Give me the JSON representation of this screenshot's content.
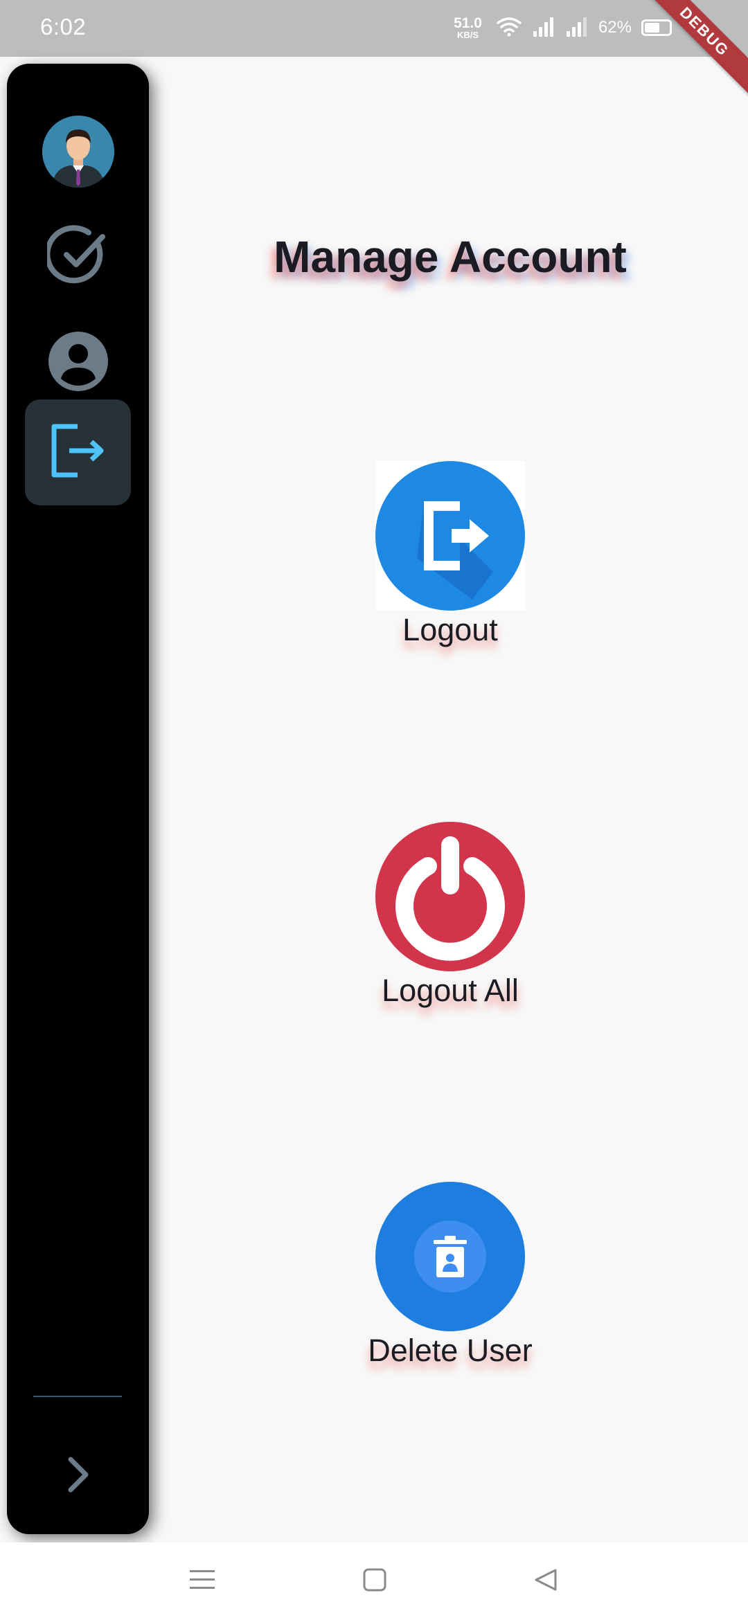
{
  "status_bar": {
    "time": "6:02",
    "net_speed_value": "51.0",
    "net_speed_unit": "KB/S",
    "battery_percent": "62%",
    "battery_level": 0.62
  },
  "debug_banner": "DEBUG",
  "sidebar": {
    "items": [
      {
        "name": "avatar",
        "icon": "user-avatar"
      },
      {
        "name": "tasks",
        "icon": "check-circle-icon"
      },
      {
        "name": "profile",
        "icon": "account-circle-icon"
      },
      {
        "name": "logout",
        "icon": "logout-icon",
        "active": true
      }
    ],
    "expand_icon": "chevron-right-icon",
    "accent_color": "#4fc3f7"
  },
  "main": {
    "title": "Manage Account",
    "actions": [
      {
        "label": "Logout",
        "icon": "logout-icon",
        "color": "#1e88e5"
      },
      {
        "label": "Logout All",
        "icon": "power-icon",
        "color": "#d1344b"
      },
      {
        "label": "Delete User",
        "icon": "delete-user-icon",
        "color": "#1e7ee0"
      }
    ]
  },
  "nav_bar": {
    "buttons": [
      "menu-icon",
      "home-square-icon",
      "back-triangle-icon"
    ]
  }
}
